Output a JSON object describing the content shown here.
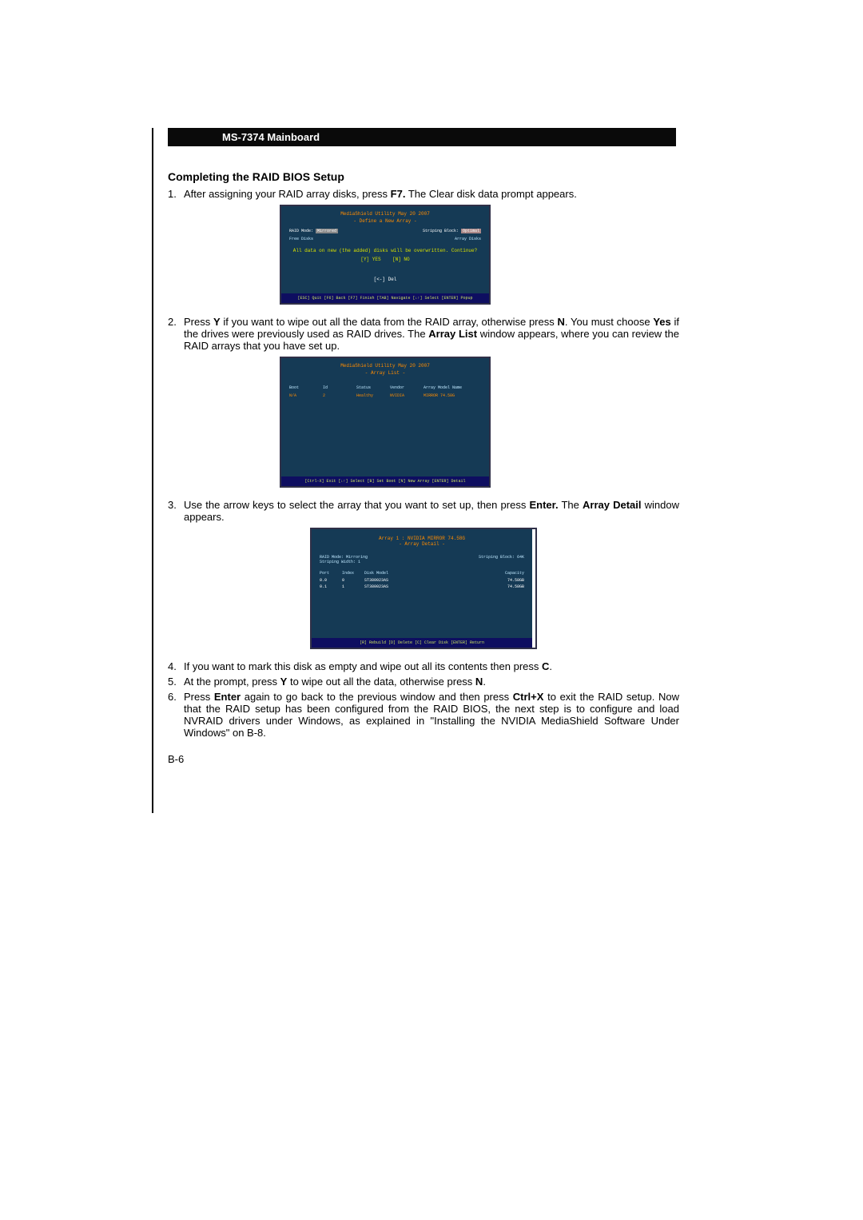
{
  "header": {
    "title": "MS-7374 Mainboard"
  },
  "section": {
    "title": "Completing the RAID BIOS Setup"
  },
  "steps": {
    "s1": "After assigning your RAID array disks, press <b>F7.</b> The Clear disk data prompt appears.",
    "s2": "Press <b>Y</b> if you want to wipe out all the data from the RAID array, otherwise press <b>N</b>. You must choose <b>Yes</b> if the drives were previously used as RAID drives. The <b>Array List</b> window appears, where you can review the RAID arrays that you have set up.",
    "s3": "Use the arrow keys to select the array that you want to set up, then press <b>Enter.</b> The <b>Array Detail</b> window appears.",
    "s4": "If you want to mark this disk as empty and wipe out all its contents then press <b>C</b>.",
    "s5": "At the prompt, press <b>Y</b> to wipe out all the data, otherwise press <b>N</b>.",
    "s6": "Press <b>Enter</b> again to go back to the previous window and then press <b>Ctrl+X</b> to exit the RAID setup. Now that the RAID setup has been configured from the RAID BIOS, the next step is to configure and load NVRAID drivers under Windows, as explained in \"Installing the NVIDIA MediaShield Software Under Windows\" on B-8."
  },
  "fig1": {
    "title": "MediaShield Utility   May 20 2007",
    "sub": "- Define a New Array -",
    "raid_mode_label": "RAID Mode:",
    "raid_mode_value": "Mirrored",
    "strip_label": "Striping Block:",
    "strip_value": "Optimal",
    "free_label": "Free Disks",
    "array_label": "Array Disks",
    "warn": "All data on new (the added) disks will be overwritten. Continue?",
    "yes": "[Y] YES",
    "no": "[N] NO",
    "del": "[<-] Del",
    "foot": "[ESC] Quit  [F6] Back  [F7] Finish  [TAB] Navigate  [↓↑] Select  [ENTER] Popup"
  },
  "fig2": {
    "title": "MediaShield Utility   May 20 2007",
    "sub": "- Array List -",
    "cols": [
      "Boot",
      "Id",
      "Status",
      "Vendor",
      "Array Model Name"
    ],
    "row": [
      "N/A",
      "2",
      "Healthy",
      "NVIDIA",
      "MIRROR  74.58G"
    ],
    "foot": "[Ctrl-X] Exit  [↓↑] Select  [B] Set Boot  [N] New Array  [ENTER] Detail"
  },
  "fig3": {
    "title": "Array 1 : NVIDIA MIRROR  74.58G",
    "sub": "- Array Detail -",
    "meta_left1": "RAID Mode: Mirroring",
    "meta_left2": "Striping Width: 1",
    "meta_right": "Striping Block: 64K",
    "cols": [
      "Port",
      "Index",
      "Disk Model",
      "Capacity"
    ],
    "rows": [
      [
        "0.0",
        "0",
        "ST380023AS",
        "74.58GB"
      ],
      [
        "0.1",
        "1",
        "ST380023AS",
        "74.58GB"
      ]
    ],
    "foot": "[R] Rebuild  [D] Delete  [C] Clear Disk  [ENTER] Return"
  },
  "page_num": "B-6"
}
